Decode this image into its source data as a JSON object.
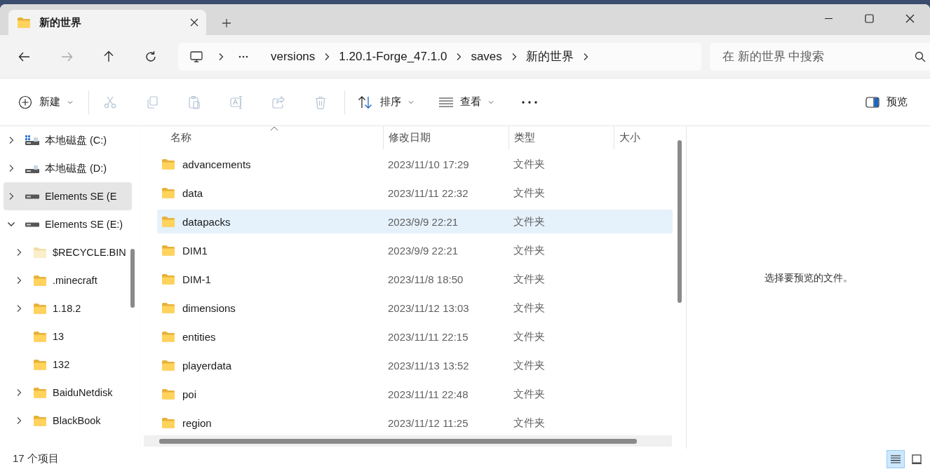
{
  "window": {
    "tab_title": "新的世界"
  },
  "nav": [
    {
      "kind": "back",
      "disabled": false
    },
    {
      "kind": "forward",
      "disabled": true
    },
    {
      "kind": "up",
      "disabled": false
    },
    {
      "kind": "refresh",
      "disabled": false
    }
  ],
  "breadcrumb": [
    "versions",
    "1.20.1-Forge_47.1.0",
    "saves",
    "新的世界"
  ],
  "search": {
    "placeholder": "在 新的世界 中搜索"
  },
  "toolbar": {
    "new_label": "新建",
    "actions": [
      {
        "kind": "cut",
        "disabled": true
      },
      {
        "kind": "copy",
        "disabled": true
      },
      {
        "kind": "paste",
        "disabled": true
      },
      {
        "kind": "rename",
        "disabled": true
      },
      {
        "kind": "share",
        "disabled": true
      },
      {
        "kind": "delete",
        "disabled": true
      }
    ],
    "sort_label": "排序",
    "view_label": "查看",
    "preview_label": "预览"
  },
  "sidebar": {
    "items": [
      {
        "kind": "drive-windows",
        "label": "本地磁盘 (C:)",
        "expanded": false,
        "selected": false
      },
      {
        "kind": "drive",
        "label": "本地磁盘 (D:)",
        "expanded": false,
        "selected": false
      },
      {
        "kind": "drive-external",
        "label": "Elements SE (E",
        "expanded": false,
        "selected": true
      },
      {
        "kind": "drive-external",
        "label": "Elements SE (E:)",
        "expanded": true,
        "selected": false,
        "children": [
          {
            "kind": "folder-hidden",
            "label": "$RECYCLE.BIN",
            "expanded": false,
            "selected": false,
            "expandable": true
          },
          {
            "kind": "folder",
            "label": ".minecraft",
            "expanded": false,
            "selected": false,
            "expandable": true
          },
          {
            "kind": "folder",
            "label": "1.18.2",
            "expanded": false,
            "selected": false,
            "expandable": true
          },
          {
            "kind": "folder",
            "label": "13",
            "expanded": false,
            "selected": false,
            "expandable": false
          },
          {
            "kind": "folder",
            "label": "132",
            "expanded": false,
            "selected": false,
            "expandable": false
          },
          {
            "kind": "folder",
            "label": "BaiduNetdisk",
            "expanded": false,
            "selected": false,
            "expandable": true
          },
          {
            "kind": "folder",
            "label": "BlackBook",
            "expanded": false,
            "selected": false,
            "expandable": true
          }
        ]
      }
    ]
  },
  "table": {
    "columns": [
      "名称",
      "修改日期",
      "类型",
      "大小"
    ],
    "rows": [
      {
        "name": "advancements",
        "modified": "2023/11/10 17:29",
        "type": "文件夹",
        "selected": false
      },
      {
        "name": "data",
        "modified": "2023/11/11 22:32",
        "type": "文件夹",
        "selected": false
      },
      {
        "name": "datapacks",
        "modified": "2023/9/9 22:21",
        "type": "文件夹",
        "selected": true
      },
      {
        "name": "DIM1",
        "modified": "2023/9/9 22:21",
        "type": "文件夹",
        "selected": false
      },
      {
        "name": "DIM-1",
        "modified": "2023/11/8 18:50",
        "type": "文件夹",
        "selected": false
      },
      {
        "name": "dimensions",
        "modified": "2023/11/12 13:03",
        "type": "文件夹",
        "selected": false
      },
      {
        "name": "entities",
        "modified": "2023/11/11 22:15",
        "type": "文件夹",
        "selected": false
      },
      {
        "name": "playerdata",
        "modified": "2023/11/13 13:52",
        "type": "文件夹",
        "selected": false
      },
      {
        "name": "poi",
        "modified": "2023/11/11 22:48",
        "type": "文件夹",
        "selected": false
      },
      {
        "name": "region",
        "modified": "2023/11/12 11:25",
        "type": "文件夹",
        "selected": false
      }
    ]
  },
  "preview": {
    "message": "选择要预览的文件。"
  },
  "status_bar": {
    "count": "17 个项目",
    "views": [
      {
        "kind": "details",
        "selected": true
      },
      {
        "kind": "tiles",
        "selected": false
      }
    ]
  }
}
